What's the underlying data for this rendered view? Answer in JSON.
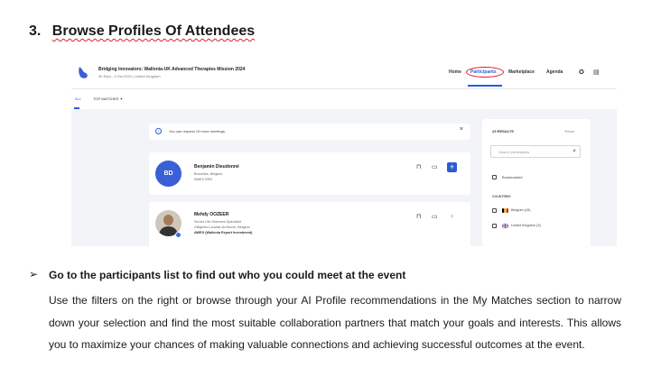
{
  "heading": {
    "number": "3.",
    "title": "Browse Profiles Of Attendees"
  },
  "screenshot": {
    "event_title": "Bridging Innovators: Wallonia-UK Advanced Therapies Mission 2024",
    "event_subtitle": "30 Sept - 3 Oct 2024 | United Kingdom",
    "nav": [
      "Home",
      "Participants",
      "Marketplace",
      "Agenda"
    ],
    "tabs": [
      "ALL",
      "TOP MATCHES"
    ],
    "notice": "You can request 19 more meetings.",
    "participants": [
      {
        "initials": "BD",
        "name": "Benjamin Dieudonné",
        "lines": [
          "Bruxelles, Belgium",
          "AWEX EEN"
        ]
      },
      {
        "name": "Mehdy OOZEER",
        "lines": [
          "Senior Life Sciences Specialist",
          "Ottignies-Louvain-la-Neuve, Belgium",
          "AWEX (Wallonia Export Investment)"
        ]
      }
    ],
    "filters": {
      "results": "23 RESULTS",
      "reset": "Reset",
      "search_placeholder": "Search participants",
      "bookmarked": "Bookmarked",
      "countries_label": "COUNTRIES",
      "countries": [
        "Belgium (19)",
        "United Kingdom (3)"
      ]
    },
    "colors": {
      "accent": "#2a5bd7",
      "highlight": "#e01b1b"
    }
  },
  "bullet": {
    "title": "Go to the participants list to find out who you could meet at the event",
    "body": "Use the filters on the right or browse through your AI Profile recommendations in the My Matches section to narrow down your selection and find the most suitable collaboration partners that match your goals and interests. This allows you to maximize your chances of making valuable connections and achieving successful outcomes at the event."
  }
}
